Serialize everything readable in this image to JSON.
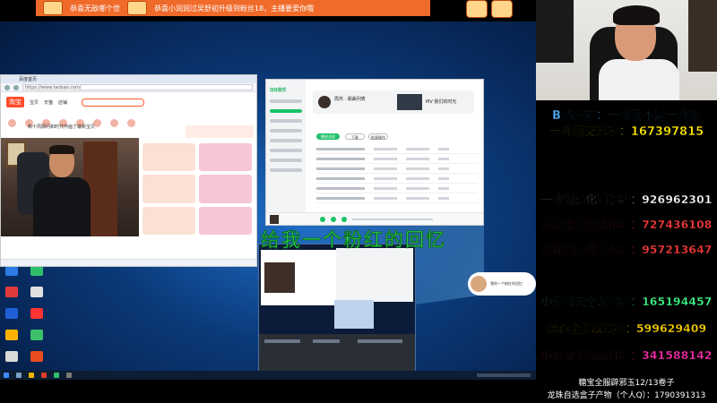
{
  "banner": {
    "msg1": "恭喜无敌哪个世",
    "msg2": "恭喜小润润过吴舒初升级到粉丝18，主播要爱你哦"
  },
  "browser": {
    "tab_title": "百度首页",
    "url": "https://www.taobao.com/",
    "logo": "淘宝",
    "tabs": [
      "宝贝",
      "天猫",
      "店铺"
    ],
    "product_line": "和十周顾问和时代作画了最新宝贝"
  },
  "player": {
    "logo": "QQ音乐",
    "artist": "周杰 · 歌曲列表",
    "song": "MV 我们的时光",
    "play_label": "播放全部",
    "download_label": "下载",
    "batch_label": "批量操作"
  },
  "danmaku": "给我一个粉红的回忆",
  "notification": "我的一个粉红的回忆",
  "info": {
    "search": "B站搜索：一阵雨不是一阵奶",
    "chat_group": "一阵雨交流群：167397815",
    "enhance_group": "一阵雨强化增幅群：926962301",
    "xiliang_group": "西凉全服游戏币群：727436108",
    "trade_group": "游戏闻账号服务群：957213647",
    "dragon_group": "小海马天空龙袍群：165194457",
    "remake_group": "娱心全服改造群：599629409",
    "boy_group": "小男孩手动帮打群：341588142",
    "promo1": "糖宝全服辟邪玉12/13卷子",
    "promo2": "龙珠自选盒子产物（个人Q）：1790391313"
  },
  "colors": {
    "blue_text": "#4fb3ff",
    "yellow_text": "#ffe600",
    "red_text": "#ff3b3b",
    "green_text": "#3cff8b",
    "pink_text": "#ff2fb0",
    "banner": "#f06a2a"
  }
}
